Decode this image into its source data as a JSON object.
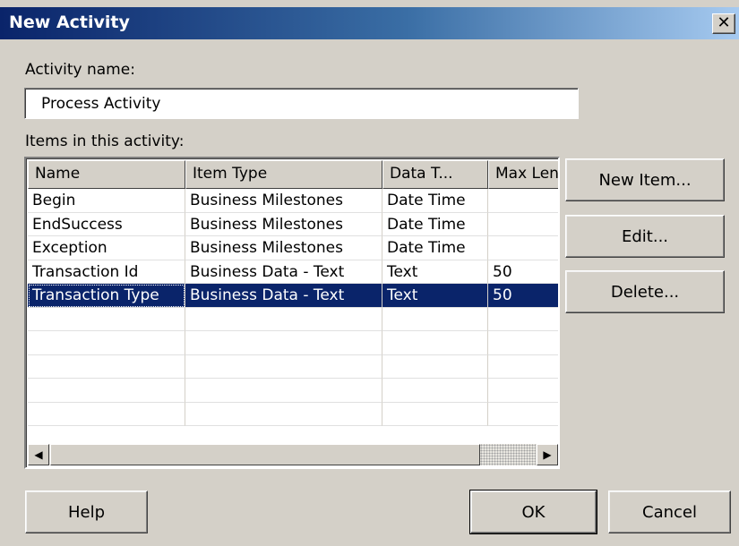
{
  "window": {
    "title": "New Activity",
    "close_glyph": "✕"
  },
  "activity_name": {
    "label": "Activity name:",
    "value": "Process Activity"
  },
  "items": {
    "label": "Items in this activity:",
    "columns": [
      "Name",
      "Item Type",
      "Data T...",
      "Max Len"
    ],
    "rows": [
      [
        "Begin",
        "Business Milestones",
        "Date Time",
        ""
      ],
      [
        "EndSuccess",
        "Business Milestones",
        "Date Time",
        ""
      ],
      [
        "Exception",
        "Business Milestones",
        "Date Time",
        ""
      ],
      [
        "Transaction Id",
        "Business Data - Text",
        "Text",
        "50"
      ],
      [
        "Transaction Type",
        "Business Data - Text",
        "Text",
        "50"
      ]
    ],
    "selected_row": 4
  },
  "side_buttons": {
    "new_item": "New Item...",
    "edit": "Edit...",
    "delete": "Delete..."
  },
  "footer_buttons": {
    "help": "Help",
    "ok": "OK",
    "cancel": "Cancel"
  },
  "colors": {
    "dialog_bg": "#d4d0c8",
    "title_start": "#0a246a",
    "title_end": "#a6caf0",
    "selection": "#0a246a"
  },
  "icons": {
    "close": "close-icon",
    "scroll_left": "arrow-left-icon",
    "scroll_right": "arrow-right-icon"
  }
}
